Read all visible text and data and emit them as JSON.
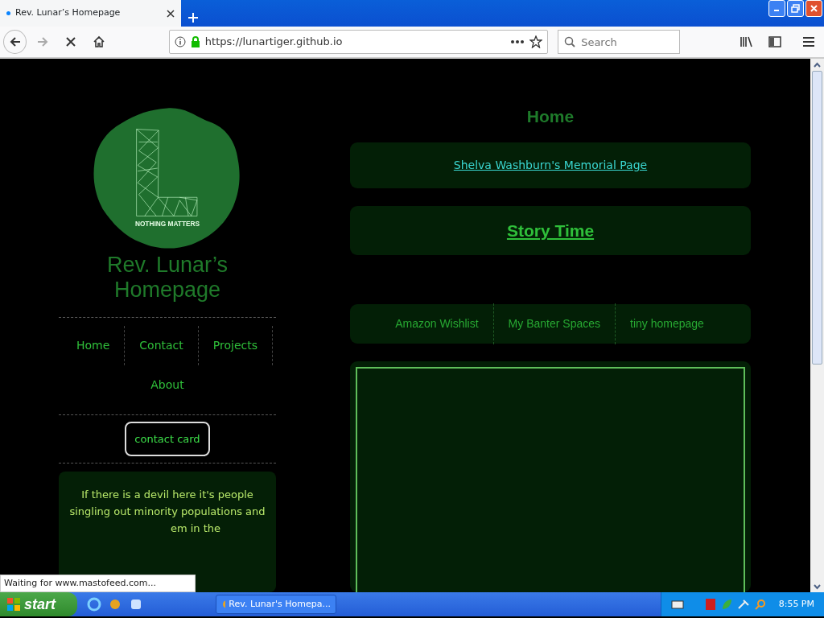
{
  "browser": {
    "tab": {
      "title": "Rev. Lunar’s Homepage",
      "loading": true
    },
    "url": "https://lunartiger.github.io",
    "search": {
      "placeholder": "Search"
    },
    "status": "Waiting for www.mastofeed.com..."
  },
  "sidebar": {
    "logo_caption": "NOTHING MATTERS",
    "site_title": "Rev. Lunar’s Homepage",
    "nav": [
      {
        "label": "Home"
      },
      {
        "label": "Contact"
      },
      {
        "label": "Projects"
      },
      {
        "label": "About"
      }
    ],
    "contact_button": "contact card",
    "quote_lines": [
      "If there is a devil here it's people",
      "singling out minority populations and",
      "em in the"
    ]
  },
  "main": {
    "heading": "Home",
    "memorial_link": "Shelva Washburn's Memorial Page",
    "story_link": "Story Time",
    "links": [
      {
        "label": "Amazon Wishlist"
      },
      {
        "label": "My Banter Spaces"
      },
      {
        "label": "tiny homepage"
      }
    ]
  },
  "taskbar": {
    "start": "start",
    "tasks": [
      {
        "label": "Rev. Lunar's Homepa...",
        "selected": false
      }
    ],
    "clock": "8:55 PM"
  }
}
